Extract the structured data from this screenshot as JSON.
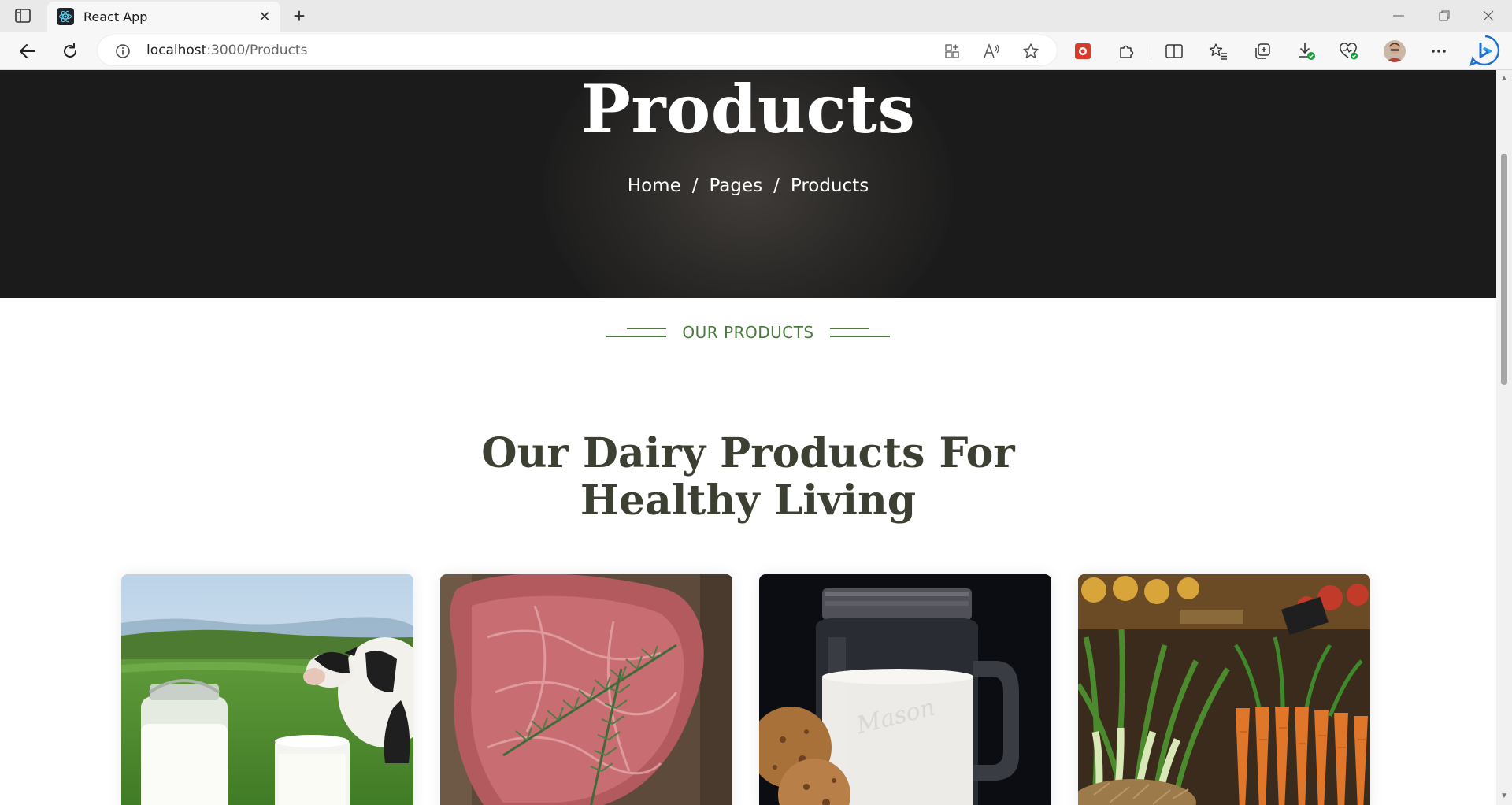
{
  "browser": {
    "tab_title": "React App",
    "url_host": "localhost",
    "url_path": ":3000/Products",
    "tab_close": "✕",
    "new_tab": "+"
  },
  "hero": {
    "title": "Products",
    "breadcrumb": [
      "Home",
      "Pages",
      "Products"
    ],
    "breadcrumb_sep": "/"
  },
  "section": {
    "kicker": "OUR PRODUCTS",
    "title_line1": "Our Dairy Products For",
    "title_line2": "Healthy Living"
  },
  "cards": [
    {
      "name": "milk-and-cow"
    },
    {
      "name": "raw-steak-with-rosemary"
    },
    {
      "name": "milk-jar-with-cookies"
    },
    {
      "name": "fresh-vegetables"
    }
  ],
  "colors": {
    "accent_green": "#4a7a3d",
    "title_dark": "#3b4032",
    "hero_bg": "#1b1b1b"
  }
}
